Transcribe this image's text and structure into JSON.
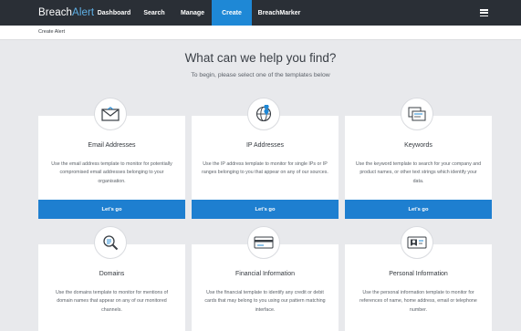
{
  "nav": {
    "brand_main": "Breach",
    "brand_accent": "Alert",
    "items": [
      {
        "label": "Dashboard"
      },
      {
        "label": "Search"
      },
      {
        "label": "Manage"
      },
      {
        "label": "Create"
      },
      {
        "label": "BreachMarker"
      }
    ],
    "active_item": "Create"
  },
  "breadcrumb": "Create Alert",
  "hero": {
    "title": "What can we help you find?",
    "subtitle": "To begin, please select one of the templates below"
  },
  "templates": [
    {
      "title": "Email Addresses",
      "description": "Use the email address template to monitor for potentially compromised email addresses belonging to your organisation.",
      "button": "Let's go",
      "icon": "envelope-icon"
    },
    {
      "title": "IP Addresses",
      "description": "Use the IP address template to monitor for single IPs or IP ranges belonging to you that appear on any of our sources.",
      "button": "Let's go",
      "icon": "globe-pin-icon"
    },
    {
      "title": "Keywords",
      "description": "Use the keyword template to search for your company and product names, or other text strings which identify your data.",
      "button": "Let's go",
      "icon": "documents-icon"
    },
    {
      "title": "Domains",
      "description": "Use the domains template to monitor for mentions of domain names that appear on any of our monitored channels.",
      "icon": "magnifier-icon"
    },
    {
      "title": "Financial Information",
      "description": "Use the financial template to identify any credit or debit cards that may belong to you using our pattern matching interface.",
      "icon": "credit-card-icon"
    },
    {
      "title": "Personal Information",
      "description": "Use the personal information template to monitor for references of name, home address, email or telephone number.",
      "icon": "id-card-icon"
    }
  ],
  "colors": {
    "nav_bg": "#2a2f36",
    "accent": "#1e88d6",
    "button": "#1e7fd0",
    "page_bg": "#e8e9ec"
  }
}
